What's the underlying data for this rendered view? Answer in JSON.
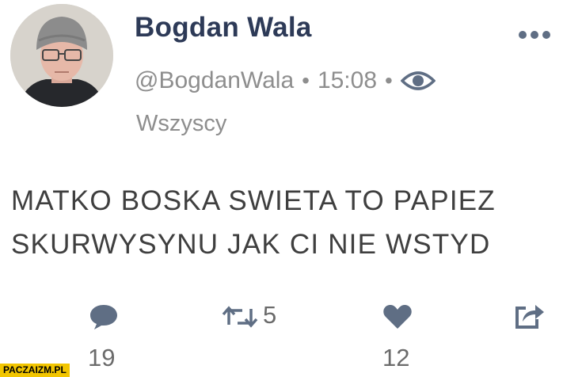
{
  "tweet": {
    "author_name": "Bogdan Wala",
    "handle": "@BogdanWala",
    "separator": "•",
    "time": "15:08",
    "audience": "Wszyscy",
    "text_lines": [
      "MATKO BOSKA SWIETA TO PAPIEZ",
      "SKURWYSYNU JAK CI NIE WSTYD"
    ]
  },
  "actions": {
    "reply_count": "19",
    "retweet_count": "5",
    "like_count": "12"
  },
  "icons": {
    "avatar": "profile-photo",
    "more": "more-dots-icon",
    "visibility": "eye-icon",
    "reply": "speech-bubble-icon",
    "retweet": "retweet-arrows-icon",
    "like": "heart-icon",
    "share": "share-icon"
  },
  "colors": {
    "name": "#2d3a57",
    "meta_text": "#8e8e8e",
    "body_text": "#3f3f3f",
    "icons": "#5f6e84",
    "watermark_bg": "#f2c500"
  },
  "watermark": "PACZAIZM.PL"
}
